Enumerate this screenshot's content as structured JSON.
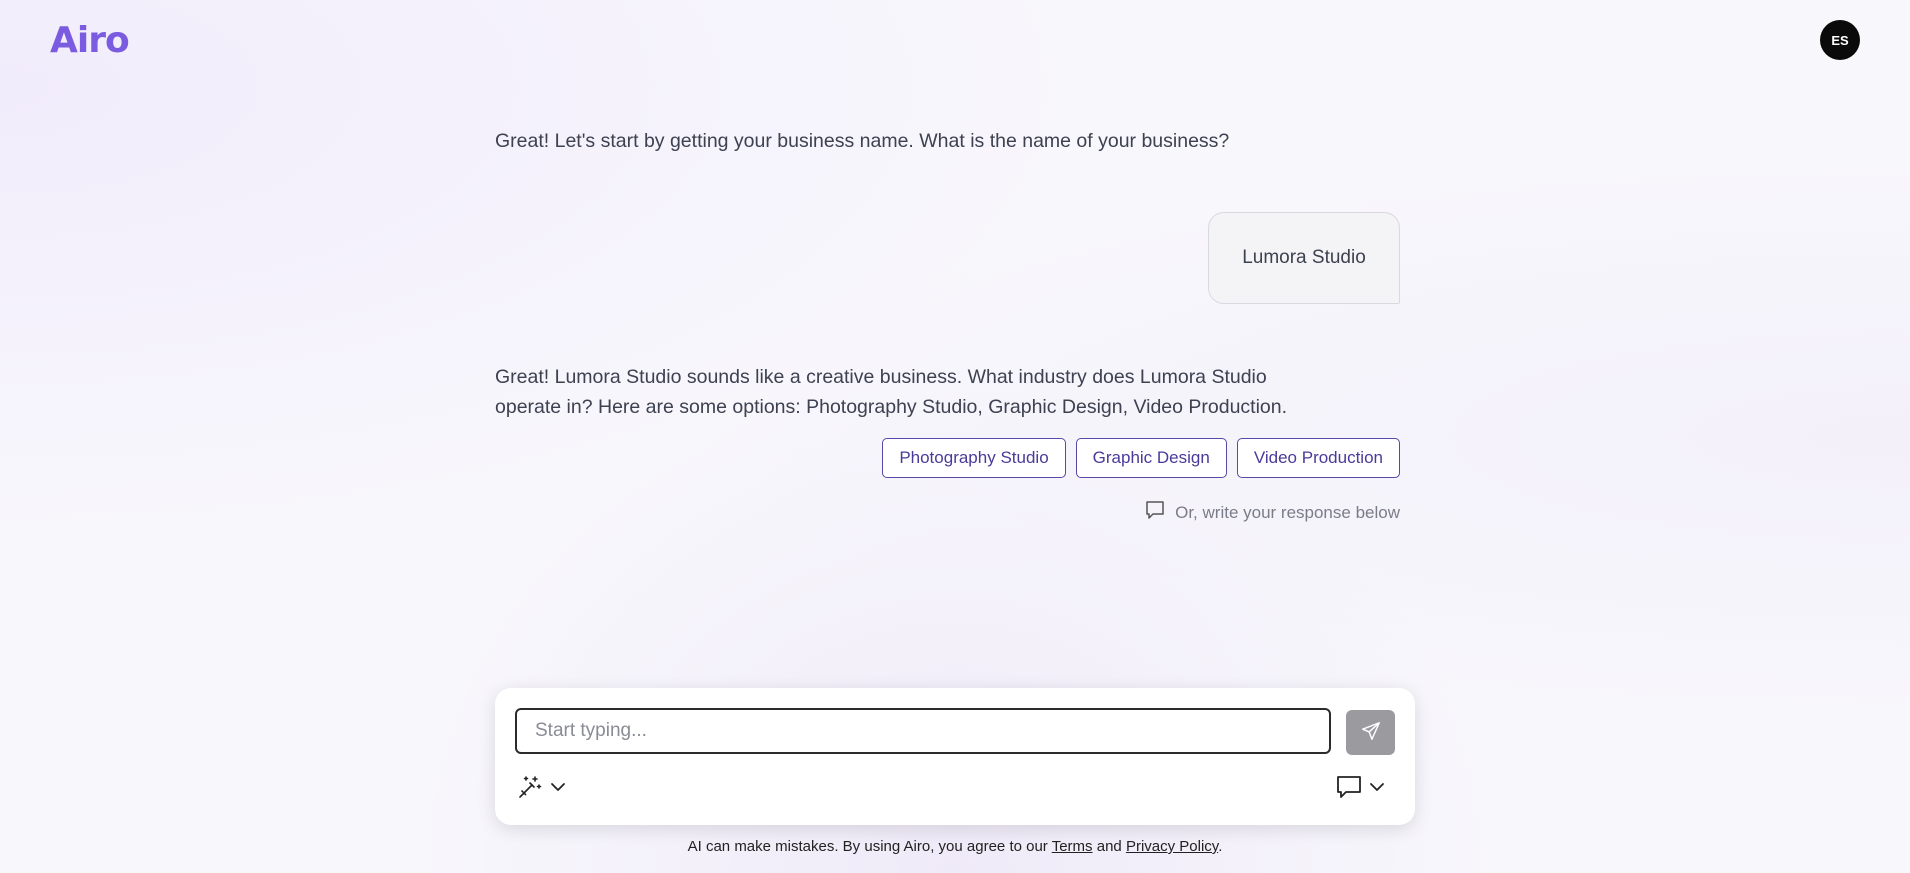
{
  "header": {
    "logo_text": "Airo",
    "avatar_initials": "ES"
  },
  "conversation": {
    "assistant_message_1": "Great! Let's start by getting your business name. What is the name of your business?",
    "user_message_1": "Lumora Studio",
    "assistant_message_2": "Great! Lumora Studio sounds like a creative business. What industry does Lumora Studio operate in? Here are some options: Photography Studio, Graphic Design, Video Production.",
    "options": [
      {
        "label": "Photography Studio"
      },
      {
        "label": "Graphic Design"
      },
      {
        "label": "Video Production"
      }
    ],
    "write_hint": "Or, write your response below"
  },
  "composer": {
    "placeholder": "Start typing...",
    "value": ""
  },
  "footer": {
    "text_before": "AI can make mistakes. By using Airo, you agree to our",
    "terms_label": "Terms",
    "and_text": "and",
    "privacy_label": "Privacy Policy",
    "period": "."
  },
  "colors": {
    "brand": "#7b5ce0",
    "option_border": "#5b47a8",
    "send_button": "#9b9b9f"
  },
  "icons": {
    "send": "send-icon",
    "magic": "magic-wand-icon",
    "chat": "chat-bubble-icon",
    "chevron": "chevron-down-icon"
  }
}
